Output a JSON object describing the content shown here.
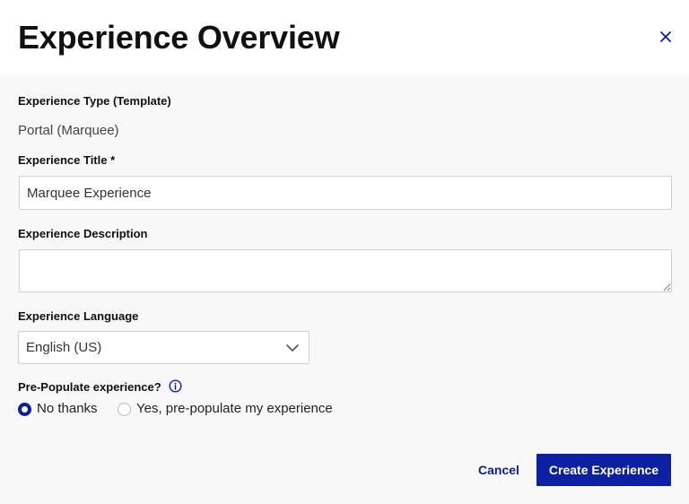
{
  "modal": {
    "title": "Experience Overview",
    "close_icon": "close-icon"
  },
  "form": {
    "type": {
      "label": "Experience Type (Template)",
      "value": "Portal (Marquee)"
    },
    "title": {
      "label": "Experience Title *",
      "value": "Marquee Experience"
    },
    "description": {
      "label": "Experience Description",
      "value": ""
    },
    "language": {
      "label": "Experience Language",
      "selected": "English (US)",
      "icon": "chevron-down-icon"
    },
    "prepopulate": {
      "label": "Pre-Populate experience?",
      "info_icon": "info-icon",
      "options": [
        {
          "label": "No thanks",
          "checked": true
        },
        {
          "label": "Yes, pre-populate my experience",
          "checked": false
        }
      ]
    }
  },
  "footer": {
    "cancel_label": "Cancel",
    "submit_label": "Create Experience"
  },
  "colors": {
    "accent": "#0d1fa3",
    "background": "#f8f8f8",
    "header_background": "#ffffff",
    "border": "#cfcfcf"
  }
}
